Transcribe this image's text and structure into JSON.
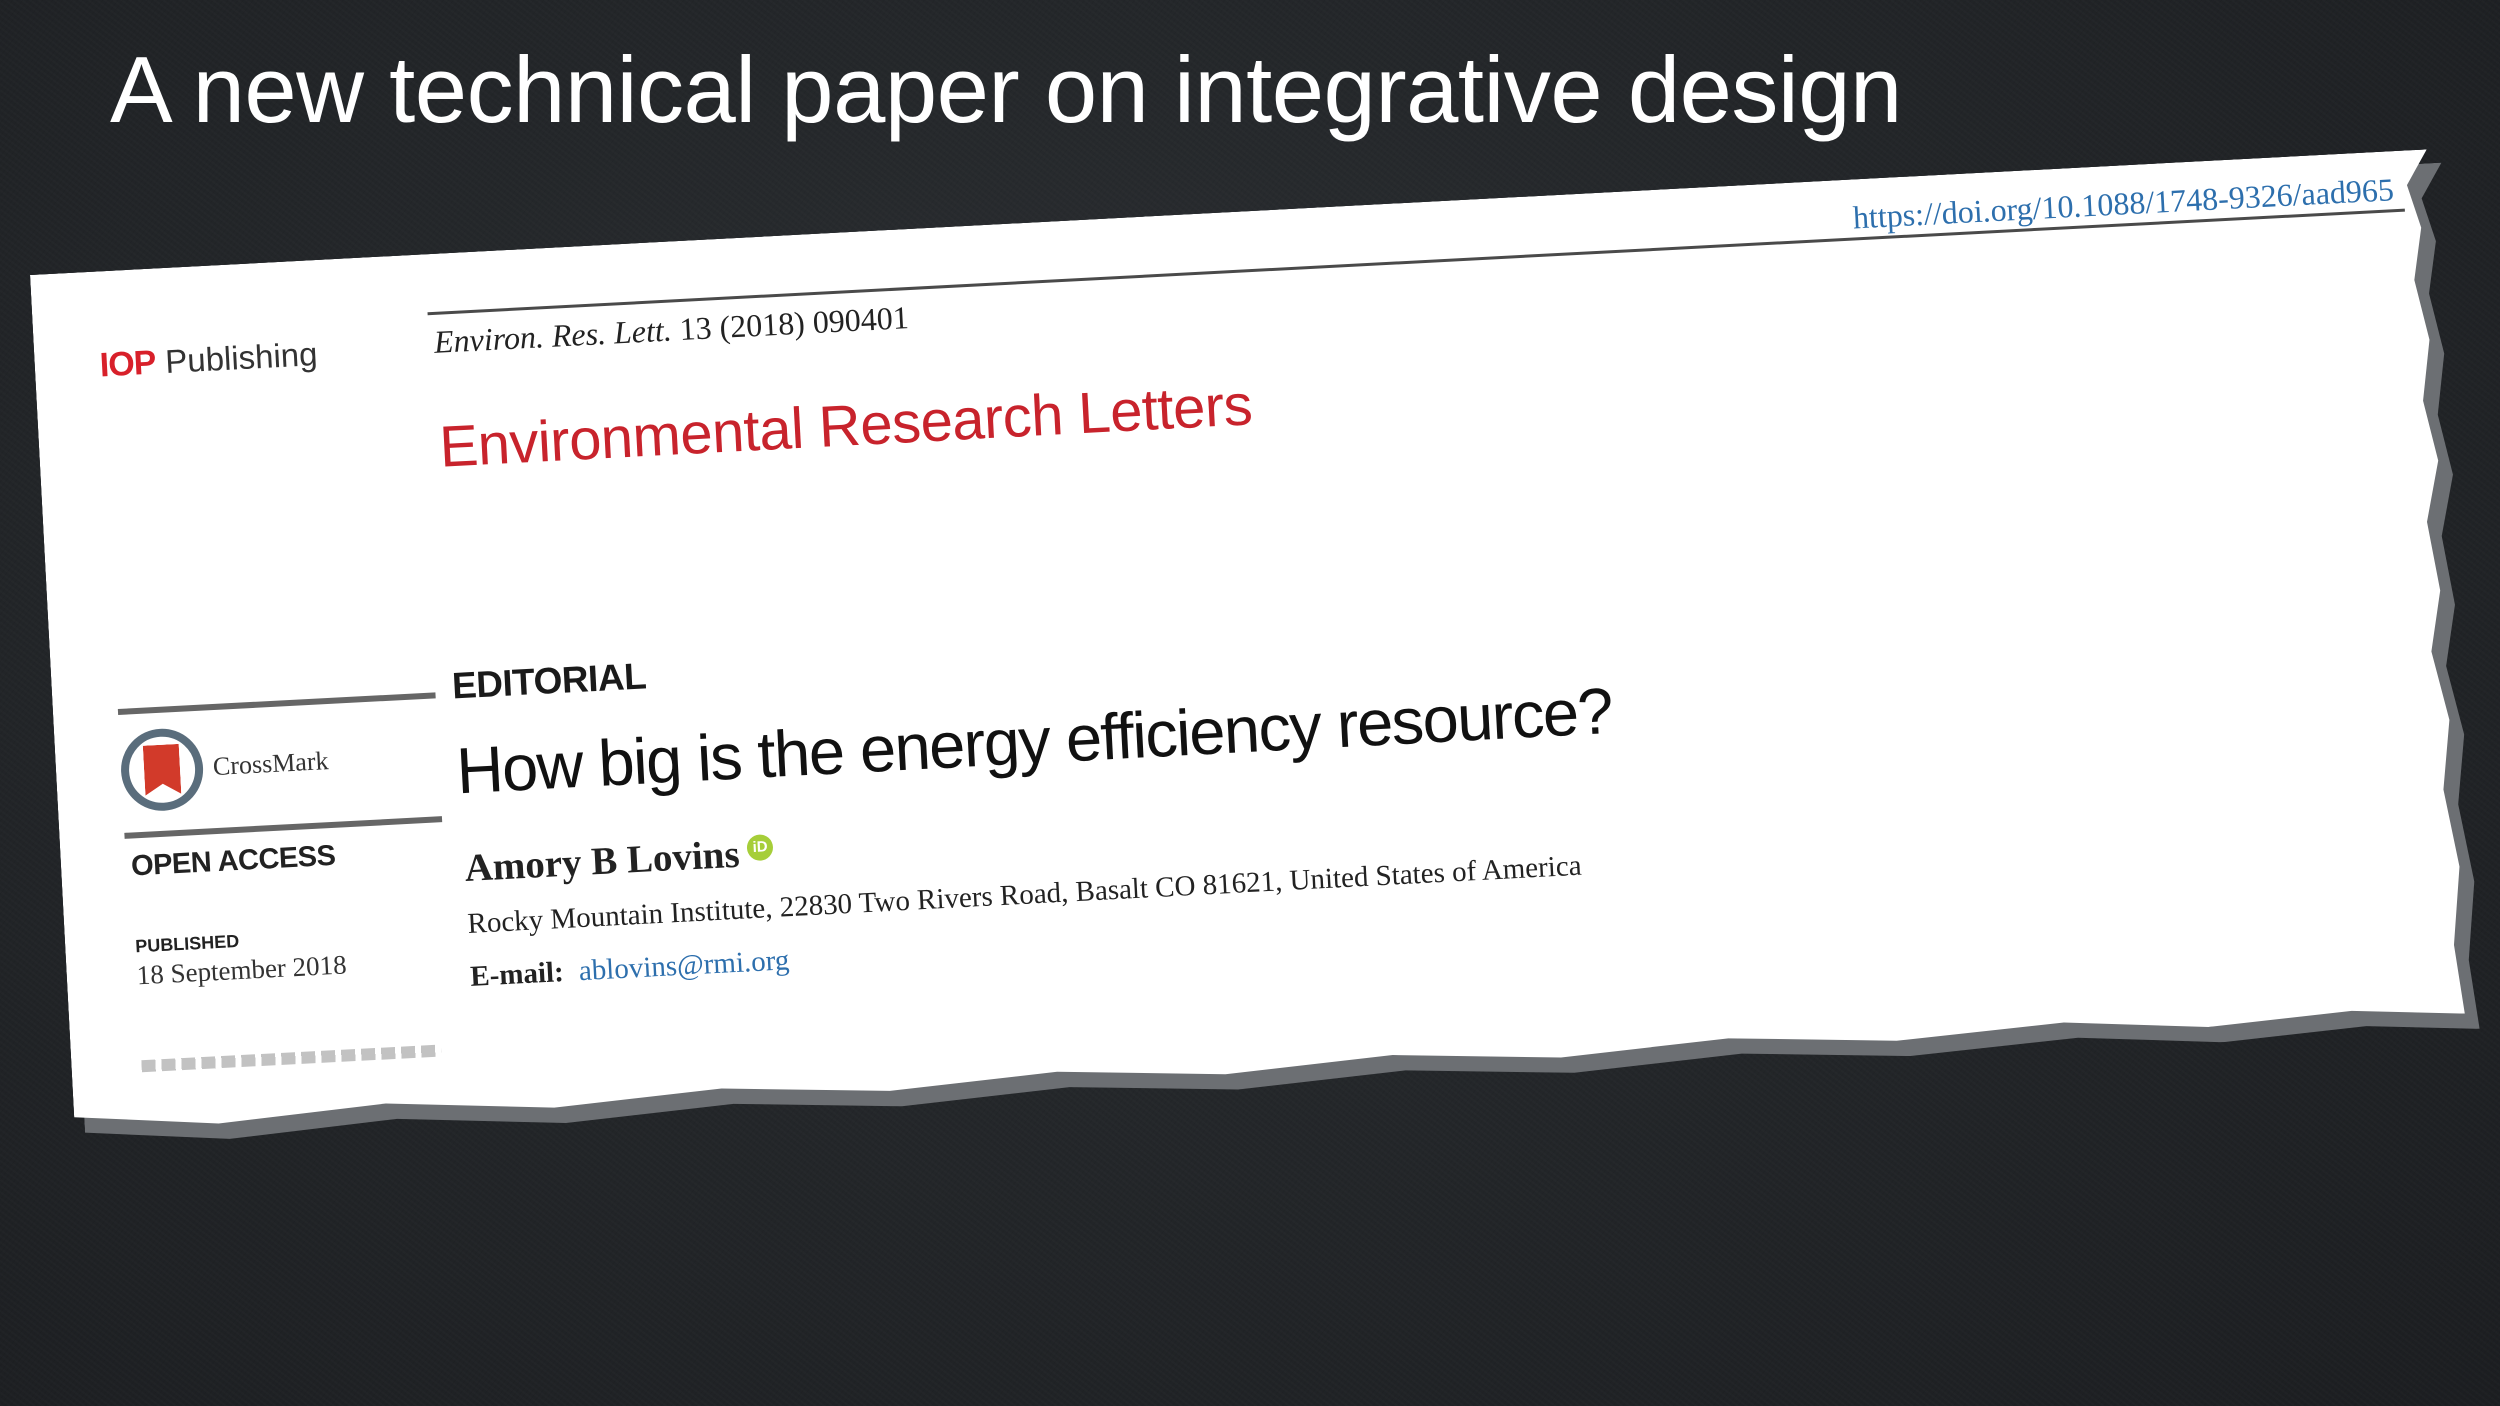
{
  "slide": {
    "title": "A new technical paper on integrative design"
  },
  "paper": {
    "publisher_mark": "IOP",
    "publisher_word": "Publishing",
    "citation_journal": "Environ. Res. Lett.",
    "citation_rest": "13 (2018) 090401",
    "doi": "https://doi.org/10.1088/1748-9326/aad965",
    "journal_title": "Environmental Research Letters",
    "crossmark_label": "CrossMark",
    "open_access": "OPEN ACCESS",
    "published_label": "PUBLISHED",
    "published_date": "18 September 2018",
    "article_type": "EDITORIAL",
    "article_title": "How big is the energy efficiency resource?",
    "author": "Amory B Lovins",
    "orcid_glyph": "iD",
    "affiliation": "Rocky Mountain Institute, 22830 Two Rivers Road, Basalt CO 81621, United States of America",
    "email_label": "E-mail:",
    "email": "ablovins@rmi.org"
  },
  "colors": {
    "background": "#24272a",
    "title_text": "#ffffff",
    "journal_red": "#c8232c",
    "link_blue": "#2d6fad",
    "orcid_green": "#a6ce39"
  },
  "icons": {
    "crossmark": "crossmark-icon",
    "orcid": "orcid-icon"
  }
}
